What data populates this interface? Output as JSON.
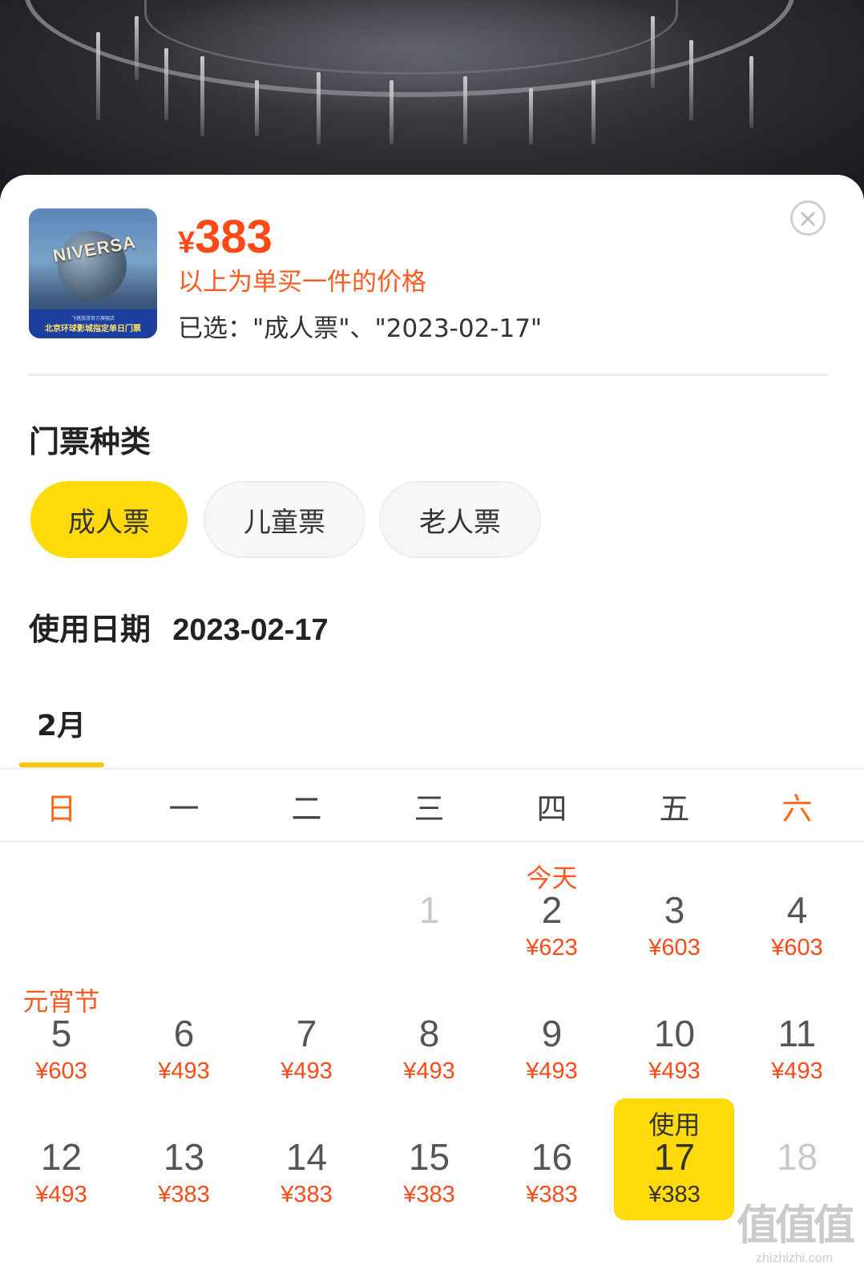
{
  "product": {
    "price_symbol": "¥",
    "price_value": "383",
    "price_note": "以上为单买一件的价格",
    "selected_text": "已选：\"成人票\"、\"2023-02-17\"",
    "thumbnail": {
      "logo_text": "NIVERSA",
      "band_small_text": "飞猪旅游官方旗舰店",
      "band_main_text": "北京环球影城指定单日门票"
    }
  },
  "close_icon": "close-icon",
  "ticket_type": {
    "title": "门票种类",
    "options": [
      {
        "label": "成人票",
        "active": true
      },
      {
        "label": "儿童票",
        "active": false
      },
      {
        "label": "老人票",
        "active": false
      }
    ]
  },
  "date_section": {
    "label": "使用日期",
    "value": "2023-02-17"
  },
  "calendar": {
    "month_tab": "2月",
    "weekdays": [
      "日",
      "一",
      "二",
      "三",
      "四",
      "五",
      "六"
    ],
    "weekend_color": "#ff6a16",
    "rows": [
      [
        {
          "day": "",
          "price": "",
          "tag": ""
        },
        {
          "day": "",
          "price": "",
          "tag": ""
        },
        {
          "day": "",
          "price": "",
          "tag": ""
        },
        {
          "day": "1",
          "price": "",
          "tag": "",
          "disabled": true
        },
        {
          "day": "2",
          "price": "¥623",
          "tag": "今天"
        },
        {
          "day": "3",
          "price": "¥603",
          "tag": ""
        },
        {
          "day": "4",
          "price": "¥603",
          "tag": ""
        }
      ],
      [
        {
          "day": "5",
          "price": "¥603",
          "tag": "元宵节"
        },
        {
          "day": "6",
          "price": "¥493",
          "tag": ""
        },
        {
          "day": "7",
          "price": "¥493",
          "tag": ""
        },
        {
          "day": "8",
          "price": "¥493",
          "tag": ""
        },
        {
          "day": "9",
          "price": "¥493",
          "tag": ""
        },
        {
          "day": "10",
          "price": "¥493",
          "tag": ""
        },
        {
          "day": "11",
          "price": "¥493",
          "tag": ""
        }
      ],
      [
        {
          "day": "12",
          "price": "¥493",
          "tag": ""
        },
        {
          "day": "13",
          "price": "¥383",
          "tag": ""
        },
        {
          "day": "14",
          "price": "¥383",
          "tag": ""
        },
        {
          "day": "15",
          "price": "¥383",
          "tag": ""
        },
        {
          "day": "16",
          "price": "¥383",
          "tag": ""
        },
        {
          "day": "17",
          "price": "¥383",
          "tag": "使用",
          "selected": true
        },
        {
          "day": "18",
          "price": "",
          "tag": "",
          "disabled": true
        }
      ]
    ]
  },
  "watermark": {
    "text": "值值值",
    "domain": "zhizhizhi.com"
  },
  "colors": {
    "accent_yellow": "#ffda0a",
    "price_red": "#ff4a17"
  }
}
